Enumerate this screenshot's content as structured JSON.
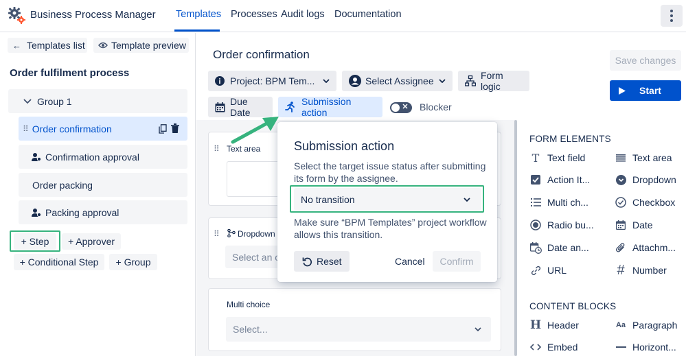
{
  "app": {
    "title": "Business Process Manager"
  },
  "nav": {
    "tabs": [
      "Templates",
      "Processes",
      "Audit logs",
      "Documentation"
    ],
    "active": "Templates"
  },
  "left": {
    "back_button": "Templates list",
    "preview_button": "Template preview",
    "process_title": "Order fulfilment process",
    "group": "Group 1",
    "steps": [
      {
        "label": "Order confirmation",
        "type": "step",
        "selected": true
      },
      {
        "label": "Confirmation approval",
        "type": "approver"
      },
      {
        "label": "Order packing",
        "type": "step"
      },
      {
        "label": "Packing approval",
        "type": "approver"
      }
    ],
    "add_step": "+ Step",
    "add_approver": "+ Approver",
    "add_conditional": "+ Conditional Step",
    "add_group": "+ Group"
  },
  "main": {
    "title": "Order confirmation",
    "project_btn": "Project: BPM Tem...",
    "assignee_btn": "Select Assignee",
    "form_logic_btn": "Form logic",
    "due_date_btn": "Due Date",
    "submission_btn": "Submission action",
    "blocker_label": "Blocker",
    "save_button": "Save changes",
    "start_button": "Start",
    "cards": {
      "text_area_label": "Text area",
      "dropdown_label": "Dropdown",
      "dropdown_placeholder": "Select an op",
      "multi_label": "Multi choice",
      "multi_placeholder": "Select..."
    }
  },
  "popup": {
    "title": "Submission action",
    "description": "Select the target issue status after submitting its form by the assignee.",
    "description_line1": "Select the target issue status after submitting",
    "description_line2": "its form by the assignee.",
    "select_value": "No transition",
    "note_line1": "Make sure “BPM Templates” project workflow",
    "note_line2": "allows this transition.",
    "reset": "Reset",
    "cancel": "Cancel",
    "confirm": "Confirm"
  },
  "right": {
    "form_elements_header": "FORM ELEMENTS",
    "form_elements": [
      {
        "label": "Text field",
        "icon": "text-field-icon"
      },
      {
        "label": "Text area",
        "icon": "text-area-icon"
      },
      {
        "label": "Action It...",
        "icon": "checkbox-checked-icon"
      },
      {
        "label": "Dropdown",
        "icon": "dropdown-circle-icon"
      },
      {
        "label": "Multi ch...",
        "icon": "list-icon"
      },
      {
        "label": "Checkbox",
        "icon": "check-circle-icon"
      },
      {
        "label": "Radio bu...",
        "icon": "radio-icon"
      },
      {
        "label": "Date",
        "icon": "calendar-icon"
      },
      {
        "label": "Date an...",
        "icon": "calendar-clock-icon"
      },
      {
        "label": "Attachm...",
        "icon": "paperclip-icon"
      },
      {
        "label": "URL",
        "icon": "link-icon"
      },
      {
        "label": "Number",
        "icon": "hash-icon"
      }
    ],
    "content_blocks_header": "CONTENT BLOCKS",
    "content_blocks": [
      {
        "label": "Header",
        "icon": "header-icon"
      },
      {
        "label": "Paragraph",
        "icon": "paragraph-icon"
      },
      {
        "label": "Embed",
        "icon": "embed-icon"
      },
      {
        "label": "Horizont...",
        "icon": "horizontal-line-icon"
      }
    ]
  },
  "colors": {
    "primary": "#0052CC",
    "highlight": "#36B37E",
    "selected_bg": "#DEEBFF"
  }
}
